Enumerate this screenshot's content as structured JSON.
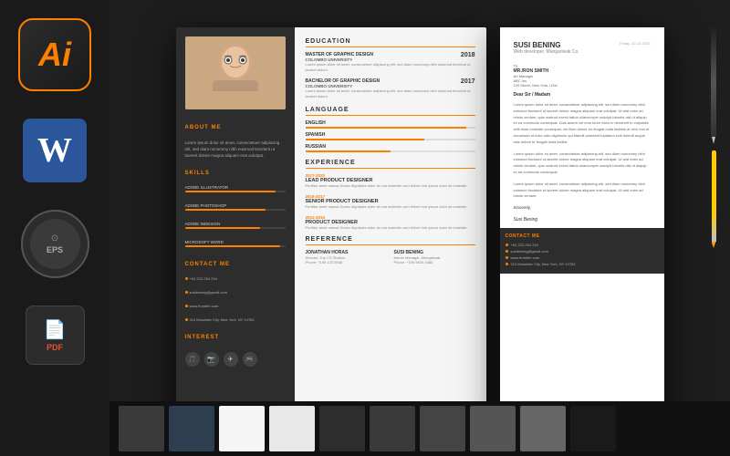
{
  "desktop": {
    "background_color": "#1e1e1e"
  },
  "dock": {
    "icons": [
      {
        "id": "ai",
        "label": "Ai",
        "type": "ai"
      },
      {
        "id": "word",
        "label": "W",
        "type": "word"
      },
      {
        "id": "eps",
        "label": "EPS",
        "type": "eps"
      },
      {
        "id": "pdf",
        "label": "PDF",
        "type": "pdf"
      }
    ]
  },
  "resume": {
    "left_sidebar": {
      "photo_placeholder": "👩",
      "about_me_title": "ABOUT ME",
      "about_me_text": "Lorem ipsum dolor sit amet, consectetuer adipiscing elit, sed diam nonummy nibh euismod tincidunt ut laoreet dolore magna aliquam erat volutpat.",
      "skills_title": "SKILLS",
      "skills": [
        {
          "name": "ADOBE ILLUSTRATOR",
          "percent": 90
        },
        {
          "name": "ADOBE PHOTOSHOP",
          "percent": 80
        },
        {
          "name": "ADOBE INDESIGN",
          "percent": 75
        },
        {
          "name": "MICROSOFT WORD",
          "percent": 95
        }
      ],
      "contact_me_title": "CONTACT ME",
      "contacts": [
        "+62 222-334 234",
        "susibening@gmail.com",
        "www.frontdirt.com",
        "312 Mountain City, New York, NY 10783"
      ],
      "interest_title": "INTEREST",
      "interests": [
        "🎵",
        "📷",
        "✈️",
        "🎮"
      ]
    },
    "right_main": {
      "education_title": "EDUCATION",
      "education_items": [
        {
          "degree": "MASTER OF GRAPHIC DESIGN",
          "school": "COLOMBO UNIVERSITY",
          "year": "2018",
          "desc": "Lorem ipsum dolor sit amet, consectetuer adipiscing elit, sed diam nonummy nibh euismod tincidunt ut laoreet dolore."
        },
        {
          "degree": "BACHELOR OF GRAPHIC DESIGN",
          "school": "COLOMBO UNIVERSITY",
          "year": "2017",
          "desc": "Lorem ipsum dolor sit amet, consectetuer adipiscing elit, sed diam nonummy nibh euismod tincidunt ut laoreet dolore."
        }
      ],
      "language_title": "LANGUAGE",
      "languages": [
        {
          "name": "ENGLISH",
          "percent": 95
        },
        {
          "name": "SPANISH",
          "percent": 70
        },
        {
          "name": "RUSSIAN",
          "percent": 50
        }
      ],
      "experience_title": "EXPERIENCE",
      "experiences": [
        {
          "period": "2017-2020",
          "title": "LEAD PRODUCT DESIGNER",
          "desc": "Porttitor amet massa Donec dignissim doler at mal molestie cum tellore lore ipsum dolor sit molestie."
        },
        {
          "period": "2016-2017",
          "title": "SENIOR PRODUCT DESIGNER",
          "desc": "Porttitor amet massa Donec dignissim doler at mal molestie cum tellore lore ipsum dolor sit molestie."
        },
        {
          "period": "2012-2016",
          "title": "PRODUCT DESIGNER",
          "desc": "Porttitor amet massa Donec dignissim doler at mal molestie cum tellore lore ipsum dolor sit molestie."
        }
      ],
      "reference_title": "REFERENCE",
      "references": [
        {
          "name": "JONATHAN HORAS",
          "title": "Director, Top CS Studios",
          "phone": "Phone: +196 123 5948"
        },
        {
          "name": "SUSI BENING",
          "title": "Admin Manager, Mangarwak",
          "phone": "Phone: +196 5634 4486"
        }
      ]
    }
  },
  "cover_letter": {
    "recipient_name": "SUSI BENING",
    "recipient_title": "Web developer, Mangariwak Co.",
    "to_label": "To:",
    "recipient_full": "MR./RON SMITH",
    "recipient_role": "Art Manager",
    "recipient_company": "ABC Inc.",
    "address": "120 Street, New York, USA",
    "date": "Friday, 10-10-2023",
    "greeting": "Dear Sir / Madam",
    "paragraphs": [
      "Lorem ipsum dolor sit amet, consectetuer adipiscing elit, sed diam nonummy nibh euismod tincidunt ut laoreet dolore magna aliquam erat volutpat. Ut wisi enim ad minim veniam, quis nostrud exerci tation ullamcorper suscipit lobortis nisl ut aliquip ex ea commodo consequat. Duis autem vel eum iriure dolor in hendrerit in vulputate velit esse molestie consequat, vel illum dolore eu feugiat nulla facilisis at vero eos et accumsan et iusto odio dignissim qui blandit praesent luptatum zzril delenit augue duis dolore te feugait nulla facilisi.",
      "Lorem ipsum dolor sit amet, consectetuer adipiscing elit, sed diam nonummy nibh euismod tincidunt ut laoreet dolore magna aliquam erat volutpat. Ut wisi enim ad minim veniam, quis nostrud exerci tation ullamcorper suscipit lobortis nisl ut aliquip ex ea commodo consequat.",
      "Lorem ipsum dolor sit amet, consectetuer adipiscing elit, sed diam nonummy nibh euismod tincidunt ut laoreet dolore magna aliquam erat volutpat. Ut wisi enim ad minim veniam."
    ],
    "closing": "Sincerely,",
    "signature": "Susi Bening",
    "contact_me_title": "Contact Me",
    "contacts": [
      "+62 222-334 234",
      "susibening@gmail.com",
      "www.frontdirt.com",
      "312 Mountain City, New York, NY 10783"
    ]
  }
}
